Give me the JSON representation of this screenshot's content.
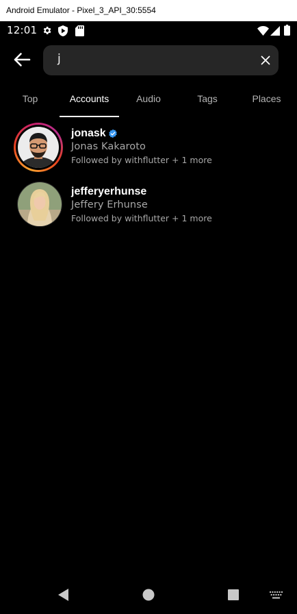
{
  "window": {
    "title": "Android Emulator - Pixel_3_API_30:5554"
  },
  "status_bar": {
    "time": "12:01"
  },
  "search": {
    "query": "j"
  },
  "tabs": [
    {
      "label": "Top"
    },
    {
      "label": "Accounts",
      "active": true
    },
    {
      "label": "Audio"
    },
    {
      "label": "Tags"
    },
    {
      "label": "Places"
    }
  ],
  "results": [
    {
      "username": "jonask",
      "verified": true,
      "full_name": "Jonas Kakaroto",
      "followed_by": "Followed by withflutter + 1 more",
      "has_story": true
    },
    {
      "username": "jefferyerhunse",
      "verified": false,
      "full_name": "Jeffery Erhunse",
      "followed_by": "Followed by withflutter + 1 more",
      "has_story": false
    }
  ],
  "colors": {
    "background": "#000000",
    "search_field": "#262626",
    "verified_badge": "#3897f0",
    "secondary_text": "#a8a8a8"
  }
}
